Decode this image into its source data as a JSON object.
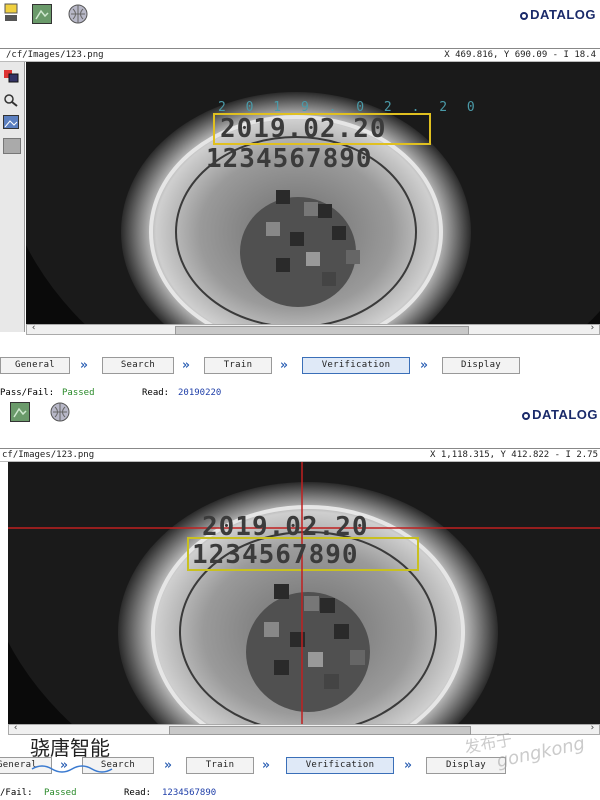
{
  "brand": "DATALOG",
  "accent_color": "#1e3ea8",
  "pass_color": "#2a8a2a",
  "icons": [
    "gear-icon",
    "image-icon",
    "globe-icon",
    "zoom-icon",
    "picture-icon",
    "palette-icon"
  ],
  "top_panel": {
    "path": "/cf/Images/123.png",
    "coords": "X 469.816,  Y 690.09  - I 18.4",
    "ocr_text_1": "2019.02.20",
    "ocr_text_2": "1234567890",
    "ocr_overlay_label": "2 0 1 9 . 0 2 . 2 0",
    "steps": [
      "General",
      "Search",
      "Train",
      "Verification",
      "Display"
    ],
    "active_step": "Verification",
    "pass_fail_label": "Pass/Fail:",
    "pass_fail_value": "Passed",
    "read_label": "Read:",
    "read_value": "20190220"
  },
  "bottom_panel": {
    "path": "cf/Images/123.png",
    "coords": "X 1,118.315,  Y 412.822  - I 2.75",
    "ocr_text_1": "2019.02.20",
    "ocr_text_2": "1234567890",
    "steps": [
      "General",
      "Search",
      "Train",
      "Verification",
      "Display"
    ],
    "active_step": "Verification",
    "pass_fail_label": "/Fail:",
    "pass_fail_value": "Passed",
    "read_label": "Read:",
    "read_value": "1234567890"
  },
  "watermark": {
    "company": "骁唐智能",
    "site_cn": "发布于",
    "site": "gongkong"
  }
}
